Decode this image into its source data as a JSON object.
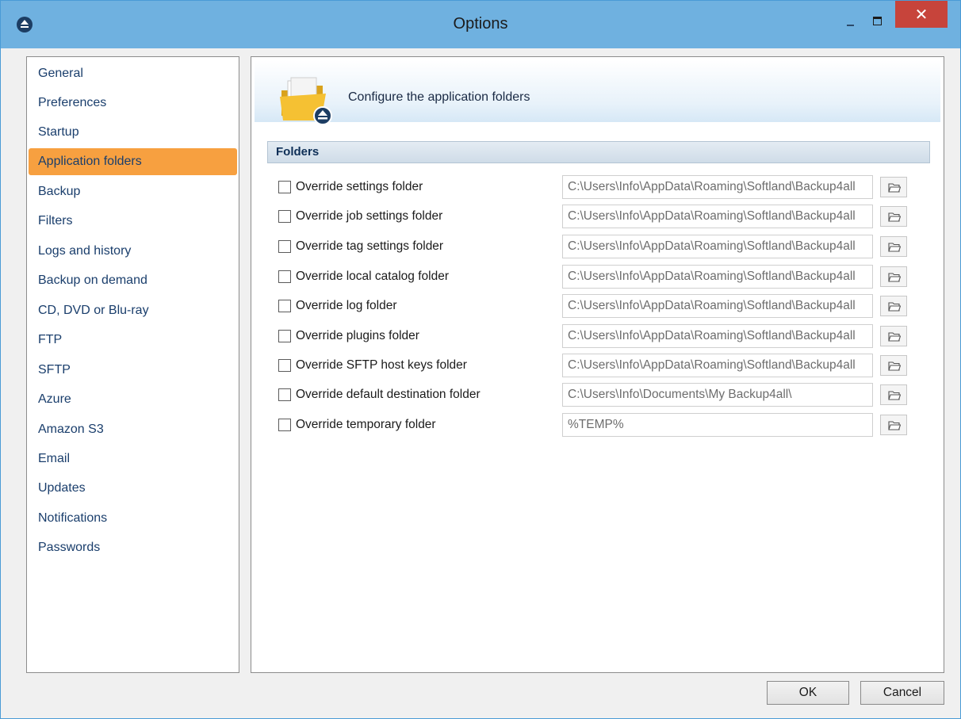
{
  "window": {
    "title": "Options",
    "close_glyph": "✕"
  },
  "sidebar": {
    "items": [
      {
        "label": "General",
        "selected": false
      },
      {
        "label": "Preferences",
        "selected": false
      },
      {
        "label": "Startup",
        "selected": false
      },
      {
        "label": "Application folders",
        "selected": true
      },
      {
        "label": "Backup",
        "selected": false
      },
      {
        "label": "Filters",
        "selected": false
      },
      {
        "label": "Logs and history",
        "selected": false
      },
      {
        "label": "Backup on demand",
        "selected": false
      },
      {
        "label": "CD, DVD or Blu-ray",
        "selected": false
      },
      {
        "label": "FTP",
        "selected": false
      },
      {
        "label": "SFTP",
        "selected": false
      },
      {
        "label": "Azure",
        "selected": false
      },
      {
        "label": "Amazon S3",
        "selected": false
      },
      {
        "label": "Email",
        "selected": false
      },
      {
        "label": "Updates",
        "selected": false
      },
      {
        "label": "Notifications",
        "selected": false
      },
      {
        "label": "Passwords",
        "selected": false
      }
    ]
  },
  "content": {
    "header_title": "Configure the application folders",
    "section_title": "Folders",
    "rows": [
      {
        "label": "Override settings folder",
        "checked": false,
        "path": "C:\\Users\\Info\\AppData\\Roaming\\Softland\\Backup4all"
      },
      {
        "label": "Override job settings folder",
        "checked": false,
        "path": "C:\\Users\\Info\\AppData\\Roaming\\Softland\\Backup4all"
      },
      {
        "label": "Override tag settings folder",
        "checked": false,
        "path": "C:\\Users\\Info\\AppData\\Roaming\\Softland\\Backup4all"
      },
      {
        "label": "Override local catalog folder",
        "checked": false,
        "path": "C:\\Users\\Info\\AppData\\Roaming\\Softland\\Backup4all"
      },
      {
        "label": "Override log folder",
        "checked": false,
        "path": "C:\\Users\\Info\\AppData\\Roaming\\Softland\\Backup4all"
      },
      {
        "label": "Override plugins folder",
        "checked": false,
        "path": "C:\\Users\\Info\\AppData\\Roaming\\Softland\\Backup4all"
      },
      {
        "label": "Override SFTP host keys folder",
        "checked": false,
        "path": "C:\\Users\\Info\\AppData\\Roaming\\Softland\\Backup4all"
      },
      {
        "label": "Override default destination folder",
        "checked": false,
        "path": "C:\\Users\\Info\\Documents\\My Backup4all\\"
      },
      {
        "label": "Override temporary folder",
        "checked": false,
        "path": "%TEMP%"
      }
    ]
  },
  "footer": {
    "ok_label": "OK",
    "cancel_label": "Cancel"
  },
  "colors": {
    "titlebar": "#6fb1e0",
    "selected_item": "#f7a040",
    "close_button": "#c7443b"
  }
}
